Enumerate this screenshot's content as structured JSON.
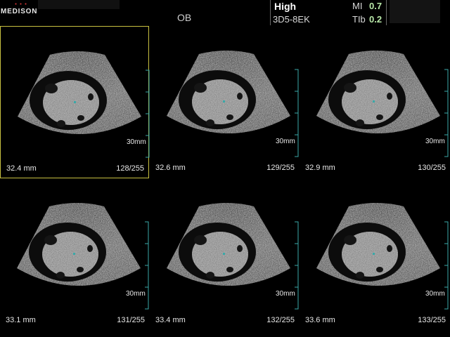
{
  "header": {
    "brand": "MEDISON",
    "exam_mode": "OB",
    "power": "High",
    "probe": "3D5-8EK",
    "mi_label": "MI",
    "mi_value": "0.7",
    "tib_label": "TIb",
    "tib_value": "0.2"
  },
  "panels": [
    {
      "depth": "32.4 mm",
      "slice": "128/255",
      "scale": "30mm",
      "selected": true
    },
    {
      "depth": "32.6 mm",
      "slice": "129/255",
      "scale": "30mm",
      "selected": false
    },
    {
      "depth": "32.9 mm",
      "slice": "130/255",
      "scale": "30mm",
      "selected": false
    },
    {
      "depth": "33.1 mm",
      "slice": "131/255",
      "scale": "30mm",
      "selected": false
    },
    {
      "depth": "33.4 mm",
      "slice": "132/255",
      "scale": "30mm",
      "selected": false
    },
    {
      "depth": "33.6 mm",
      "slice": "133/255",
      "scale": "30mm",
      "selected": false
    }
  ],
  "colors": {
    "selection_border": "#c8c040",
    "ruler": "#3aa8a8",
    "index_value": "#b8e8a8"
  },
  "icons": {
    "ruler": "depth-ruler-icon",
    "marker": "center-marker-icon"
  }
}
